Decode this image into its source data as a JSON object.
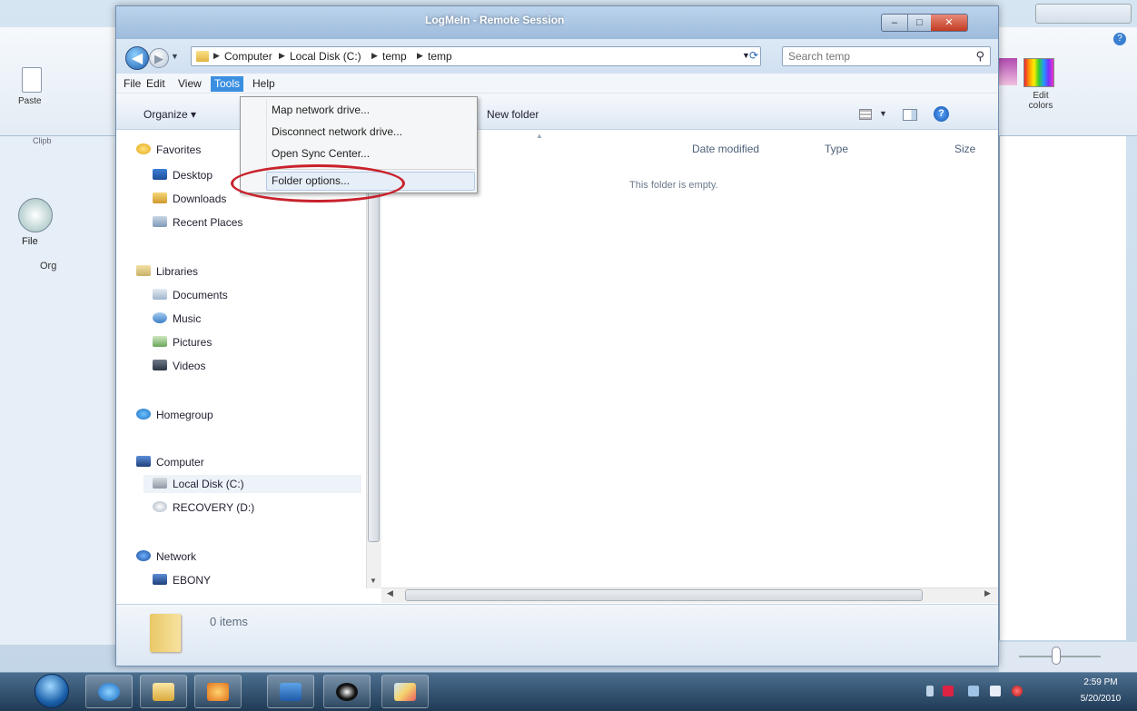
{
  "explorer": {
    "title": "LogMeIn - Remote Session",
    "caption": {
      "minimize": "–",
      "maximize": "□",
      "close": "✕"
    },
    "address": {
      "crumbs": [
        "Computer",
        "Local Disk (C:)",
        "temp",
        "temp"
      ]
    },
    "search": {
      "placeholder": "Search temp"
    },
    "menubar": [
      "File",
      "Edit",
      "View",
      "Tools",
      "Help"
    ],
    "commandbar": {
      "organize": "Organize ▾",
      "new_folder": "New folder"
    },
    "tools_menu": {
      "items": [
        "Map network drive...",
        "Disconnect network drive...",
        "Open Sync Center...",
        "Folder options..."
      ],
      "highlighted": "Folder options..."
    },
    "nav": {
      "favorites": "Favorites",
      "desktop": "Desktop",
      "downloads": "Downloads",
      "recent": "Recent Places",
      "libraries": "Libraries",
      "documents": "Documents",
      "music": "Music",
      "pictures": "Pictures",
      "videos": "Videos",
      "homegroup": "Homegroup",
      "computer": "Computer",
      "local_disk": "Local Disk (C:)",
      "recovery": "RECOVERY (D:)",
      "network": "Network",
      "ebony": "EBONY"
    },
    "columns": [
      "Date modified",
      "Type",
      "Size"
    ],
    "empty_message": "This folder is empty.",
    "details": {
      "count": "0 items"
    }
  },
  "background": {
    "paste": "Paste",
    "clipboard": "Clipb",
    "file": "File",
    "organize": "Org",
    "edit_colors": "Edit colors"
  },
  "taskbar": {
    "clock_time": "2:59 PM",
    "clock_date": "5/20/2010"
  },
  "colors": {
    "highlight_ring": "#c8222c",
    "menu_active": "#3a8fe0"
  }
}
